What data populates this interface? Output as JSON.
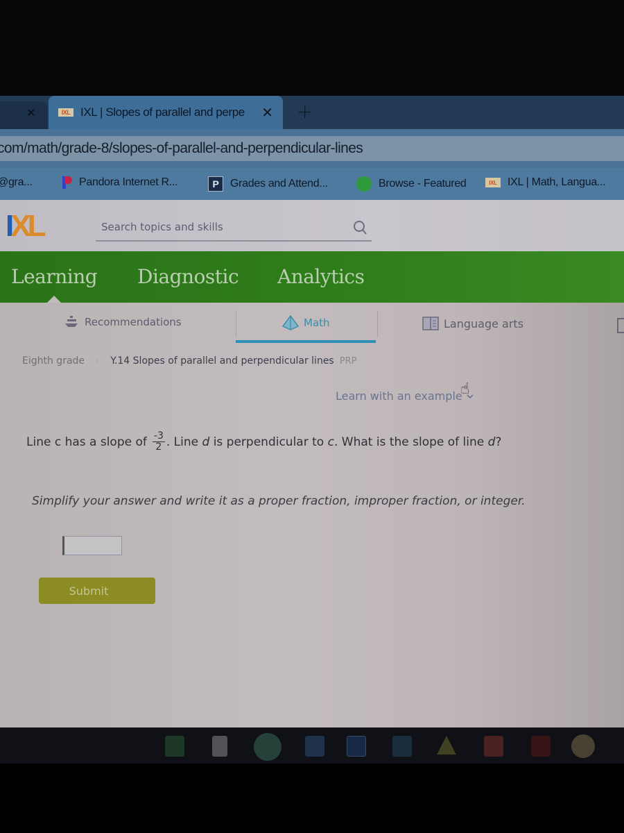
{
  "browser": {
    "tabs": [
      {
        "label": "",
        "close_icon": "×"
      },
      {
        "label": "IXL | Slopes of parallel and perpe",
        "favicon": "IXL",
        "close_icon": "✕",
        "active": true
      }
    ],
    "new_tab_icon": "+",
    "url": "com/math/grade-8/slopes-of-parallel-and-perpendicular-lines",
    "bookmarks": [
      {
        "label": "@gra...",
        "icon": "none"
      },
      {
        "label": "Pandora Internet R...",
        "icon": "pandora-icon"
      },
      {
        "label": "Grades and Attend...",
        "icon": "powerschool-icon",
        "icon_glyph": "P"
      },
      {
        "label": "Browse - Featured",
        "icon": "spotify-icon"
      },
      {
        "label": "IXL | Math, Langua...",
        "icon": "ixl-icon",
        "icon_glyph": "IXL"
      }
    ]
  },
  "ixl": {
    "logo": {
      "i": "I",
      "x": "X",
      "l": "L"
    },
    "search": {
      "placeholder": "Search topics and skills"
    },
    "nav": [
      "Learning",
      "Diagnostic",
      "Analytics"
    ],
    "active_nav": "Learning",
    "subjects": [
      {
        "label": "Recommendations",
        "icon": "recommendations-icon"
      },
      {
        "label": "Math",
        "icon": "pyramid-icon",
        "active": true
      },
      {
        "label": "Language arts",
        "icon": "book-icon"
      }
    ],
    "breadcrumb": {
      "grade": "Eighth grade",
      "separator": "›",
      "skill": "Y.14 Slopes of parallel and perpendicular lines",
      "code": "PRP"
    },
    "learn_example": "Learn with an example",
    "question": {
      "part1": "Line c has a slope of",
      "fraction": {
        "numerator": "-3",
        "denominator": "2"
      },
      "part2": ". Line ",
      "var_d": "d",
      "part3": " is perpendicular to ",
      "var_c": "c",
      "part4": ". What is the slope of line ",
      "var_d2": "d",
      "part5": "?"
    },
    "instruction": "Simplify your answer and write it as a proper fraction, improper fraction, or integer.",
    "answer": {
      "value": ""
    },
    "submit_label": "Submit"
  },
  "colors": {
    "ixl_green": "#2f7e1b",
    "math_accent": "#2f8fb4",
    "submit_olive": "#8b8c23",
    "logo_blue": "#1f5fb3",
    "logo_orange": "#db8a2c"
  },
  "taskbar": {
    "apps": [
      "sheets-icon",
      "keep-icon",
      "chrome-icon",
      "docs-icon",
      "sway-icon",
      "slides-icon",
      "drive-icon",
      "gmail-icon",
      "youtube-icon",
      "app-icon"
    ]
  }
}
